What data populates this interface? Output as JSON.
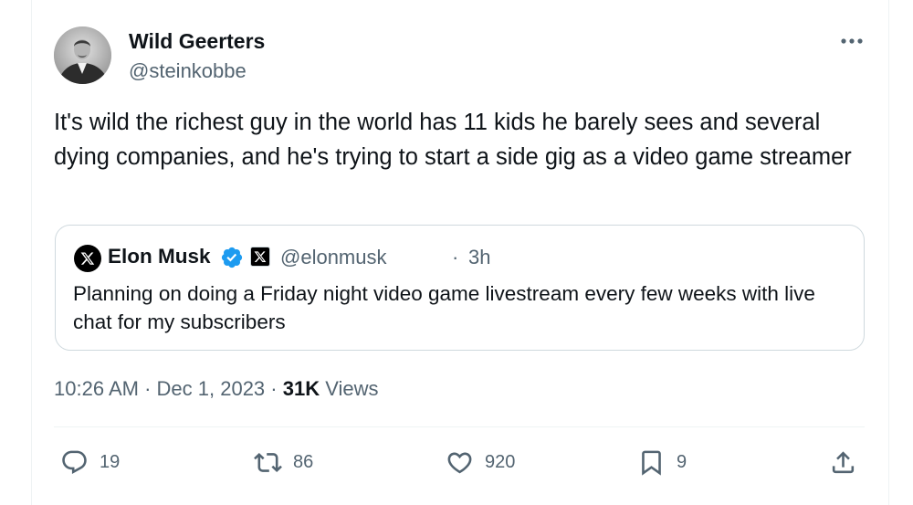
{
  "author": {
    "name": "Wild Geerters",
    "handle": "@steinkobbe"
  },
  "tweet_text": "It's wild the richest guy in the world has 11 kids he barely sees and several dying companies, and he's trying to start a side gig as a video game streamer",
  "quote": {
    "name": "Elon Musk",
    "handle": "@elonmusk",
    "separator": "·",
    "time": "3h",
    "text": "Planning on doing a Friday night video game livestream every few weeks with live chat for my subscribers"
  },
  "meta": {
    "time": "10:26 AM",
    "date": "Dec 1, 2023",
    "views_count": "31K",
    "views_label": "Views",
    "separator": "·"
  },
  "actions": {
    "replies": "19",
    "reposts": "86",
    "likes": "920",
    "bookmarks": "9"
  },
  "icons": [
    "more-icon",
    "verified-icon",
    "x-logo-icon",
    "reply-icon",
    "repost-icon",
    "like-icon",
    "bookmark-icon",
    "share-icon"
  ],
  "colors": {
    "text_primary": "#0f1419",
    "text_secondary": "#536471",
    "verified_blue": "#1d9bf0",
    "border": "#cfd9de"
  }
}
